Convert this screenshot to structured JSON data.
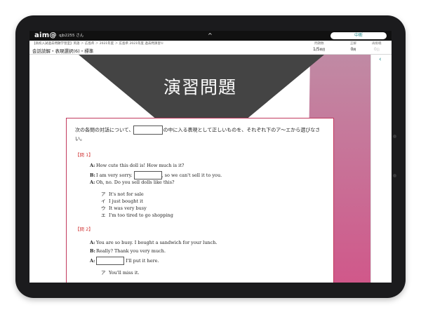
{
  "app": {
    "logo": "aim@",
    "user": "qjb2255 さん",
    "caret": "^",
    "pause_label": "中断"
  },
  "header": {
    "breadcrumb": "【高校入試過去問題学習室】英語 ＞ 広島県 ＞ 2021年度 ＞ 広島県 2021年度 過去問演習①",
    "lesson": "会話読解・表現選択(6)・標準",
    "stats": [
      {
        "label": "問題数",
        "value": "1/5",
        "unit": "問目"
      },
      {
        "label": "正解",
        "value": "0",
        "unit": "問"
      },
      {
        "label": "再挑戦",
        "value": "0",
        "unit": "回"
      }
    ]
  },
  "banner": {
    "title": "演習問題"
  },
  "question": {
    "instruction_before": "次の各問の対話について、",
    "instruction_after": "の中に入る表現として正しいものを、それぞれ下のア～エから選びなさい。",
    "q1": {
      "label": "【問 1】",
      "lines": [
        {
          "speaker": "A:",
          "before": "How cute this doll is! How much is it?",
          "after": ""
        },
        {
          "speaker": "B:",
          "before": "I am very sorry.",
          "after": ", so we can't sell it to you."
        },
        {
          "speaker": "A:",
          "before": "Oh, no. Do you sell dolls like this?",
          "after": ""
        }
      ],
      "options": [
        {
          "key": "ア",
          "text": "It's not for sale"
        },
        {
          "key": "イ",
          "text": "I just bought it"
        },
        {
          "key": "ウ",
          "text": "It was very busy"
        },
        {
          "key": "エ",
          "text": "I'm too tired to go shopping"
        }
      ]
    },
    "q2": {
      "label": "【問 2】",
      "lines": [
        {
          "speaker": "A:",
          "before": "You are so busy. I bought a sandwich for your lunch.",
          "after": ""
        },
        {
          "speaker": "B:",
          "before": "Really? Thank you very much.",
          "after": ""
        },
        {
          "speaker": "A:",
          "before": "",
          "after": "I'll put it here."
        }
      ],
      "options": [
        {
          "key": "ア",
          "text": "You'll miss it."
        }
      ]
    }
  },
  "controls": {
    "zoom_in": "+",
    "zoom_out": "−",
    "back": "‹"
  }
}
